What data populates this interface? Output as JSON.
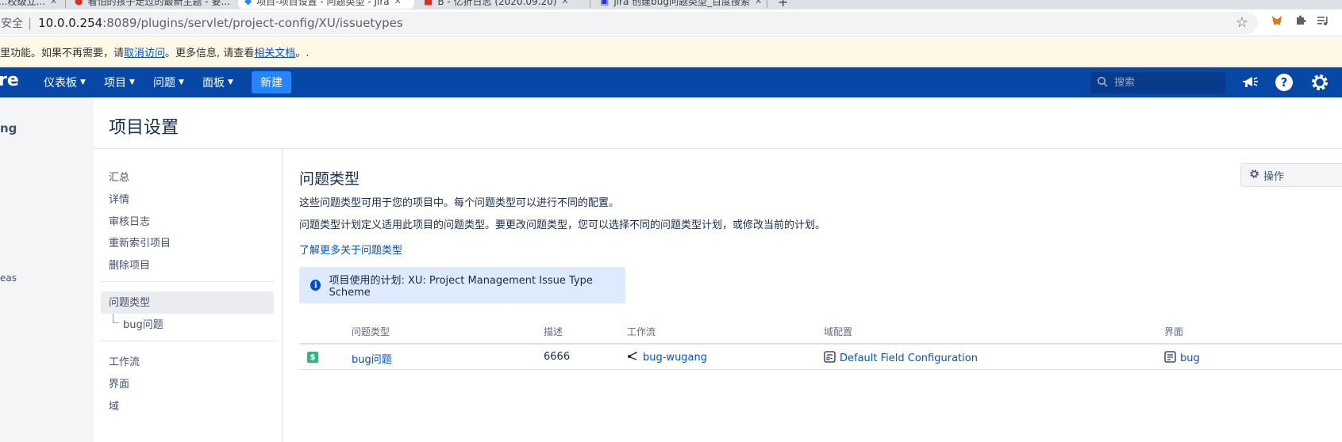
{
  "browser": {
    "tabs": [
      {
        "title": "...校级立...",
        "active": false
      },
      {
        "title": "看怕的孩子走过的最新主题 - 要...",
        "active": false
      },
      {
        "title": "项目-项目设置 - 问题类型 - Jira",
        "active": true
      },
      {
        "title": "B - 亿折日志 (2020.09.20)",
        "active": false
      },
      {
        "title": "jira 创建bug问题类型_百度搜索",
        "active": false
      }
    ],
    "security_label": "安全",
    "url_host": "10.0.0.254",
    "url_path": ":8089/plugins/servlet/project-config/XU/issuetypes",
    "icons": [
      "star-icon",
      "metamask-extension-icon",
      "puzzle-extension-icon",
      "playlist-icon"
    ]
  },
  "infobar": {
    "text_before": "里功能。如果不再需要，请 ",
    "link1": "取消访问",
    "text_middle": "。更多信息, 请查看 ",
    "link2": "相关文档",
    "text_after": "。."
  },
  "header": {
    "logo_fragment": "re",
    "nav": [
      {
        "label": "仪表板"
      },
      {
        "label": "项目"
      },
      {
        "label": "问题"
      },
      {
        "label": "面板"
      }
    ],
    "create_label": "新建",
    "search_placeholder": "搜索",
    "colors": {
      "bar": "#0747a6",
      "create": "#2684ff"
    }
  },
  "sidebar": {
    "fragment_top": "ng",
    "fragment_mid": "eas"
  },
  "page": {
    "title": "项目设置"
  },
  "settings_nav": {
    "items": [
      {
        "label": "汇总"
      },
      {
        "label": "详情"
      },
      {
        "label": "审核日志"
      },
      {
        "label": "重新索引项目"
      },
      {
        "label": "删除项目"
      },
      {
        "label": "问题类型",
        "selected": true
      },
      {
        "label": "bug问题"
      },
      {
        "label": "工作流"
      },
      {
        "label": "界面"
      },
      {
        "label": "域"
      }
    ]
  },
  "main": {
    "section_title": "问题类型",
    "desc1": "这些问题类型可用于您的项目中。每个问题类型可以进行不同的配置。",
    "desc2": "问题类型计划定义适用此项目的问题类型。要更改问题类型，您可以选择不同的问题类型计划，或修改当前的计划。",
    "learn_more": "了解更多关于问题类型",
    "actions_label": "操作",
    "scheme_info": "项目使用的计划: XU: Project Management Issue Type Scheme",
    "table": {
      "headers": [
        "问题类型",
        "描述",
        "工作流",
        "域配置",
        "界面"
      ],
      "rows": [
        {
          "issue_type": "bug问题",
          "description": "6666",
          "workflow": "bug-wugang",
          "field_config": "Default Field Configuration",
          "screen": "bug"
        }
      ]
    }
  }
}
